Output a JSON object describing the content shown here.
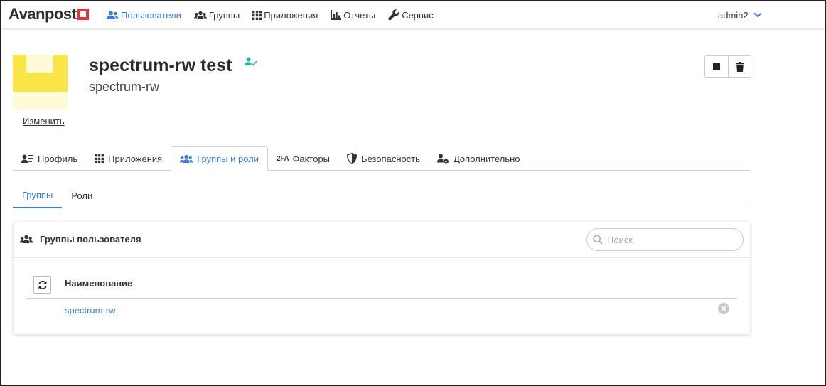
{
  "app": {
    "logo_text": "Avanpost",
    "brand_color": "#e2343a",
    "accent_color": "#3b7ddd"
  },
  "nav": {
    "items": [
      {
        "label": "Пользователи",
        "icon": "users-icon",
        "active": true
      },
      {
        "label": "Группы",
        "icon": "groups-icon",
        "active": false
      },
      {
        "label": "Приложения",
        "icon": "grid-icon",
        "active": false
      },
      {
        "label": "Отчеты",
        "icon": "bar-chart-icon",
        "active": false
      },
      {
        "label": "Сервис",
        "icon": "wrench-icon",
        "active": false
      }
    ],
    "user": "admin2"
  },
  "profile": {
    "display_name": "spectrum-rw test",
    "username": "spectrum-rw",
    "change_avatar_label": "Изменить",
    "status_icon": "user-check-icon"
  },
  "tabs": [
    {
      "label": "Профиль",
      "icon": "id-card-icon",
      "active": false
    },
    {
      "label": "Приложения",
      "icon": "grid-icon",
      "active": false
    },
    {
      "label": "Группы и роли",
      "icon": "users-icon",
      "active": true
    },
    {
      "label": "Факторы",
      "icon": "2fa-icon",
      "icon_text": "2FA",
      "active": false
    },
    {
      "label": "Безопасность",
      "icon": "shield-icon",
      "active": false
    },
    {
      "label": "Дополнительно",
      "icon": "user-gear-icon",
      "active": false
    }
  ],
  "subtabs": [
    {
      "label": "Группы",
      "active": true
    },
    {
      "label": "Роли",
      "active": false
    }
  ],
  "groups_card": {
    "title": "Группы пользователя",
    "search_placeholder": "Поиск",
    "column_header": "Наименование",
    "rows": [
      {
        "name": "spectrum-rw"
      }
    ]
  }
}
